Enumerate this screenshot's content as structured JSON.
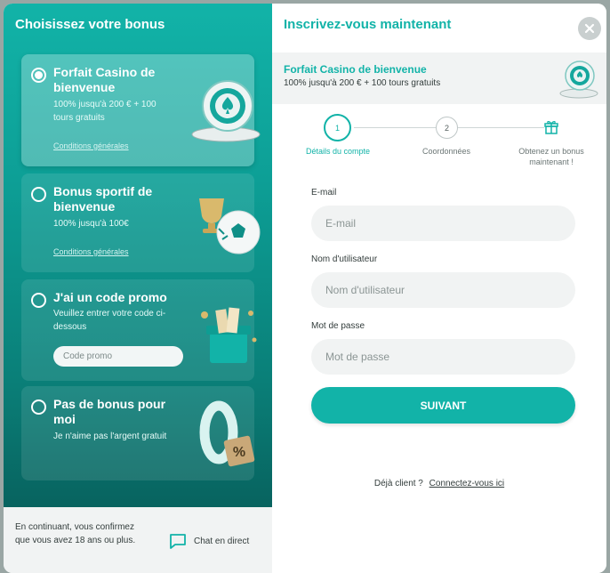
{
  "left_panel": {
    "title": "Choisissez votre bonus",
    "options": [
      {
        "title": "Forfait Casino de bienvenue",
        "description": "100% jusqu'à 200 € + 100 tours gratuits",
        "link": "Conditions générales",
        "selected": true,
        "illustration": "casino-chip-illustration"
      },
      {
        "title": "Bonus sportif de bienvenue",
        "description": "100% jusqu'à 100€",
        "link": "Conditions générales",
        "selected": false,
        "illustration": "trophy-football-illustration"
      },
      {
        "title": "J'ai un code promo",
        "description": "Veuillez entrer votre code ci-dessous",
        "input_placeholder": "Code promo",
        "selected": false,
        "illustration": "gift-box-illustration"
      },
      {
        "title": "Pas de bonus pour moi",
        "description": "Je n'aime pas l'argent gratuit",
        "selected": false,
        "illustration": "zero-percent-illustration"
      }
    ],
    "footer": {
      "text": "En continuant, vous confirmez que vous avez 18 ans ou plus.",
      "chat_label": "Chat en direct"
    }
  },
  "right_panel": {
    "title": "Inscrivez-vous maintenant",
    "offer": {
      "title": "Forfait Casino de bienvenue",
      "description": "100% jusqu'à 200 € + 100 tours gratuits"
    },
    "steps": [
      {
        "number": "1",
        "label": "Détails du compte",
        "active": true
      },
      {
        "number": "2",
        "label": "Coordonnées",
        "active": false
      },
      {
        "icon": "gift-icon",
        "label": "Obtenez un bonus maintenant !",
        "active": false
      }
    ],
    "form": {
      "email_label": "E-mail",
      "email_placeholder": "E-mail",
      "username_label": "Nom d'utilisateur",
      "username_placeholder": "Nom d'utilisateur",
      "password_label": "Mot de passe",
      "password_placeholder": "Mot de passe",
      "submit_label": "SUIVANT"
    },
    "login_prompt": "Déjà client ?",
    "login_link": "Connectez-vous ici"
  },
  "colors": {
    "accent": "#12b3a8",
    "panel_dark": "#08635f",
    "field_bg": "#f1f3f3"
  }
}
